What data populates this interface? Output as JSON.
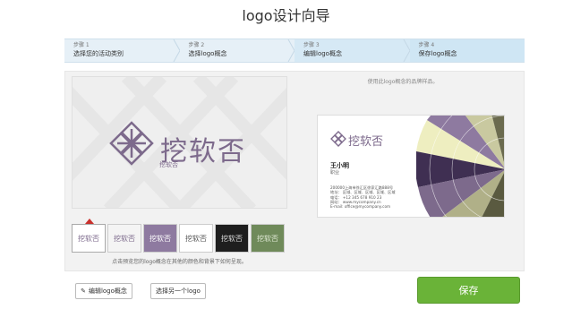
{
  "page": {
    "title": "logo设计向导"
  },
  "steps": [
    {
      "num": "步骤 1",
      "label": "选择您的活动类别"
    },
    {
      "num": "步骤 2",
      "label": "选择logo概念"
    },
    {
      "num": "步骤 3",
      "label": "编辑logo概念"
    },
    {
      "num": "步骤 4",
      "label": "保存logo概念"
    }
  ],
  "preview": {
    "logo_text": "挖软否",
    "logo_sub": "挖软否"
  },
  "caption": "使用此logo概念的品牌样品。",
  "card": {
    "logo_text": "挖软否",
    "name": "王小明",
    "role": "职业",
    "info": [
      "200000上海市徐汇区徐家汇路888号",
      "地址：  区域、区域、区域、区域、区域",
      "电话：  +12 345 678 910 23",
      "网站：  www.mycompany.cn",
      "E-mail: office@mycompany.com"
    ]
  },
  "thumbs": [
    {
      "text": "挖软否",
      "bg": "#ffffff",
      "fg": "#7d6a8c"
    },
    {
      "text": "挖软否",
      "bg": "#f4f4f4",
      "fg": "#7d6a8c"
    },
    {
      "text": "挖软否",
      "bg": "#8e7aa0",
      "fg": "#ffffff"
    },
    {
      "text": "挖软否",
      "bg": "#ffffff",
      "fg": "#555555"
    },
    {
      "text": "挖软否",
      "bg": "#1e1e1e",
      "fg": "#dddddd"
    },
    {
      "text": "挖软否",
      "bg": "#6f8a5a",
      "fg": "#dfe8d4"
    }
  ],
  "hint": "点击预览您的logo概念在其他的颜色和背景下如何呈现。",
  "buttons": {
    "edit": "编辑logo概念",
    "choose": "选择另一个logo",
    "save": "保存"
  },
  "colors": {
    "accent": "#6ab338",
    "logo": "#7d6a8c"
  }
}
